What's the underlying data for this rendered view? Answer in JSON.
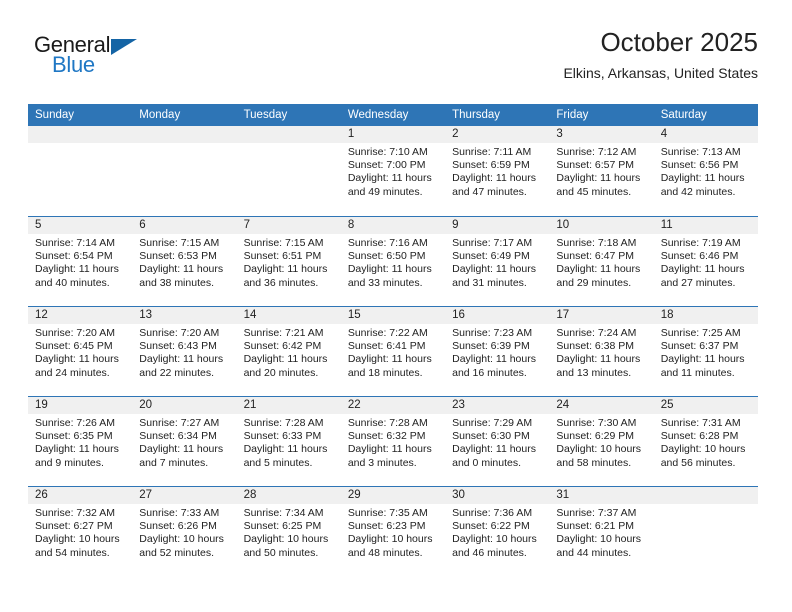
{
  "brand": {
    "name_top": "General",
    "name_bottom": "Blue",
    "triangle_icon": "triangle-icon",
    "accent_color": "#1464a5",
    "blue_text_color": "#1f77c4"
  },
  "header": {
    "title": "October 2025",
    "location": "Elkins, Arkansas, United States"
  },
  "calendar": {
    "header_bg": "#2e75b6",
    "row_border_color": "#2e75b6",
    "day_band_bg": "#f0f0f0",
    "weekdays": [
      "Sunday",
      "Monday",
      "Tuesday",
      "Wednesday",
      "Thursday",
      "Friday",
      "Saturday"
    ],
    "labels": {
      "sunrise": "Sunrise:",
      "sunset": "Sunset:",
      "daylight": "Daylight:"
    },
    "weeks": [
      [
        {
          "day": "",
          "empty": true
        },
        {
          "day": "",
          "empty": true
        },
        {
          "day": "",
          "empty": true
        },
        {
          "day": "1",
          "sunrise": "Sunrise: 7:10 AM",
          "sunset": "Sunset: 7:00 PM",
          "daylight_line1": "Daylight: 11 hours",
          "daylight_line2": "and 49 minutes."
        },
        {
          "day": "2",
          "sunrise": "Sunrise: 7:11 AM",
          "sunset": "Sunset: 6:59 PM",
          "daylight_line1": "Daylight: 11 hours",
          "daylight_line2": "and 47 minutes."
        },
        {
          "day": "3",
          "sunrise": "Sunrise: 7:12 AM",
          "sunset": "Sunset: 6:57 PM",
          "daylight_line1": "Daylight: 11 hours",
          "daylight_line2": "and 45 minutes."
        },
        {
          "day": "4",
          "sunrise": "Sunrise: 7:13 AM",
          "sunset": "Sunset: 6:56 PM",
          "daylight_line1": "Daylight: 11 hours",
          "daylight_line2": "and 42 minutes."
        }
      ],
      [
        {
          "day": "5",
          "sunrise": "Sunrise: 7:14 AM",
          "sunset": "Sunset: 6:54 PM",
          "daylight_line1": "Daylight: 11 hours",
          "daylight_line2": "and 40 minutes."
        },
        {
          "day": "6",
          "sunrise": "Sunrise: 7:15 AM",
          "sunset": "Sunset: 6:53 PM",
          "daylight_line1": "Daylight: 11 hours",
          "daylight_line2": "and 38 minutes."
        },
        {
          "day": "7",
          "sunrise": "Sunrise: 7:15 AM",
          "sunset": "Sunset: 6:51 PM",
          "daylight_line1": "Daylight: 11 hours",
          "daylight_line2": "and 36 minutes."
        },
        {
          "day": "8",
          "sunrise": "Sunrise: 7:16 AM",
          "sunset": "Sunset: 6:50 PM",
          "daylight_line1": "Daylight: 11 hours",
          "daylight_line2": "and 33 minutes."
        },
        {
          "day": "9",
          "sunrise": "Sunrise: 7:17 AM",
          "sunset": "Sunset: 6:49 PM",
          "daylight_line1": "Daylight: 11 hours",
          "daylight_line2": "and 31 minutes."
        },
        {
          "day": "10",
          "sunrise": "Sunrise: 7:18 AM",
          "sunset": "Sunset: 6:47 PM",
          "daylight_line1": "Daylight: 11 hours",
          "daylight_line2": "and 29 minutes."
        },
        {
          "day": "11",
          "sunrise": "Sunrise: 7:19 AM",
          "sunset": "Sunset: 6:46 PM",
          "daylight_line1": "Daylight: 11 hours",
          "daylight_line2": "and 27 minutes."
        }
      ],
      [
        {
          "day": "12",
          "sunrise": "Sunrise: 7:20 AM",
          "sunset": "Sunset: 6:45 PM",
          "daylight_line1": "Daylight: 11 hours",
          "daylight_line2": "and 24 minutes."
        },
        {
          "day": "13",
          "sunrise": "Sunrise: 7:20 AM",
          "sunset": "Sunset: 6:43 PM",
          "daylight_line1": "Daylight: 11 hours",
          "daylight_line2": "and 22 minutes."
        },
        {
          "day": "14",
          "sunrise": "Sunrise: 7:21 AM",
          "sunset": "Sunset: 6:42 PM",
          "daylight_line1": "Daylight: 11 hours",
          "daylight_line2": "and 20 minutes."
        },
        {
          "day": "15",
          "sunrise": "Sunrise: 7:22 AM",
          "sunset": "Sunset: 6:41 PM",
          "daylight_line1": "Daylight: 11 hours",
          "daylight_line2": "and 18 minutes."
        },
        {
          "day": "16",
          "sunrise": "Sunrise: 7:23 AM",
          "sunset": "Sunset: 6:39 PM",
          "daylight_line1": "Daylight: 11 hours",
          "daylight_line2": "and 16 minutes."
        },
        {
          "day": "17",
          "sunrise": "Sunrise: 7:24 AM",
          "sunset": "Sunset: 6:38 PM",
          "daylight_line1": "Daylight: 11 hours",
          "daylight_line2": "and 13 minutes."
        },
        {
          "day": "18",
          "sunrise": "Sunrise: 7:25 AM",
          "sunset": "Sunset: 6:37 PM",
          "daylight_line1": "Daylight: 11 hours",
          "daylight_line2": "and 11 minutes."
        }
      ],
      [
        {
          "day": "19",
          "sunrise": "Sunrise: 7:26 AM",
          "sunset": "Sunset: 6:35 PM",
          "daylight_line1": "Daylight: 11 hours",
          "daylight_line2": "and 9 minutes."
        },
        {
          "day": "20",
          "sunrise": "Sunrise: 7:27 AM",
          "sunset": "Sunset: 6:34 PM",
          "daylight_line1": "Daylight: 11 hours",
          "daylight_line2": "and 7 minutes."
        },
        {
          "day": "21",
          "sunrise": "Sunrise: 7:28 AM",
          "sunset": "Sunset: 6:33 PM",
          "daylight_line1": "Daylight: 11 hours",
          "daylight_line2": "and 5 minutes."
        },
        {
          "day": "22",
          "sunrise": "Sunrise: 7:28 AM",
          "sunset": "Sunset: 6:32 PM",
          "daylight_line1": "Daylight: 11 hours",
          "daylight_line2": "and 3 minutes."
        },
        {
          "day": "23",
          "sunrise": "Sunrise: 7:29 AM",
          "sunset": "Sunset: 6:30 PM",
          "daylight_line1": "Daylight: 11 hours",
          "daylight_line2": "and 0 minutes."
        },
        {
          "day": "24",
          "sunrise": "Sunrise: 7:30 AM",
          "sunset": "Sunset: 6:29 PM",
          "daylight_line1": "Daylight: 10 hours",
          "daylight_line2": "and 58 minutes."
        },
        {
          "day": "25",
          "sunrise": "Sunrise: 7:31 AM",
          "sunset": "Sunset: 6:28 PM",
          "daylight_line1": "Daylight: 10 hours",
          "daylight_line2": "and 56 minutes."
        }
      ],
      [
        {
          "day": "26",
          "sunrise": "Sunrise: 7:32 AM",
          "sunset": "Sunset: 6:27 PM",
          "daylight_line1": "Daylight: 10 hours",
          "daylight_line2": "and 54 minutes."
        },
        {
          "day": "27",
          "sunrise": "Sunrise: 7:33 AM",
          "sunset": "Sunset: 6:26 PM",
          "daylight_line1": "Daylight: 10 hours",
          "daylight_line2": "and 52 minutes."
        },
        {
          "day": "28",
          "sunrise": "Sunrise: 7:34 AM",
          "sunset": "Sunset: 6:25 PM",
          "daylight_line1": "Daylight: 10 hours",
          "daylight_line2": "and 50 minutes."
        },
        {
          "day": "29",
          "sunrise": "Sunrise: 7:35 AM",
          "sunset": "Sunset: 6:23 PM",
          "daylight_line1": "Daylight: 10 hours",
          "daylight_line2": "and 48 minutes."
        },
        {
          "day": "30",
          "sunrise": "Sunrise: 7:36 AM",
          "sunset": "Sunset: 6:22 PM",
          "daylight_line1": "Daylight: 10 hours",
          "daylight_line2": "and 46 minutes."
        },
        {
          "day": "31",
          "sunrise": "Sunrise: 7:37 AM",
          "sunset": "Sunset: 6:21 PM",
          "daylight_line1": "Daylight: 10 hours",
          "daylight_line2": "and 44 minutes."
        },
        {
          "day": "",
          "empty": true
        }
      ]
    ]
  }
}
